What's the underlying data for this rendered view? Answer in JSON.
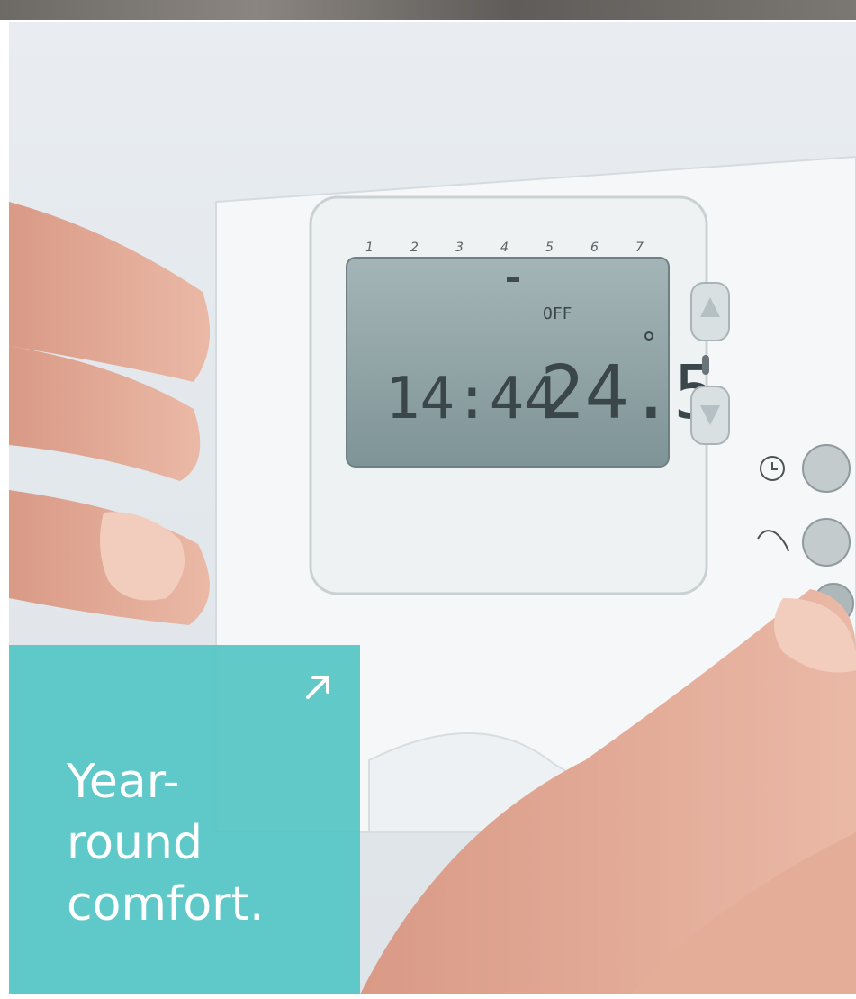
{
  "card": {
    "title_lines": [
      "Year-",
      "round",
      "comfort."
    ],
    "link_icon": "arrow-up-right-icon"
  },
  "thermostat": {
    "day_numbers": [
      "1",
      "2",
      "3",
      "4",
      "5",
      "6",
      "7"
    ],
    "status": "OFF",
    "time": "14:44",
    "temperature": "24.5"
  },
  "colors": {
    "overlay": "#54c6c4",
    "lcd": "#8fa3a6",
    "panel": "#f4f6f7"
  }
}
